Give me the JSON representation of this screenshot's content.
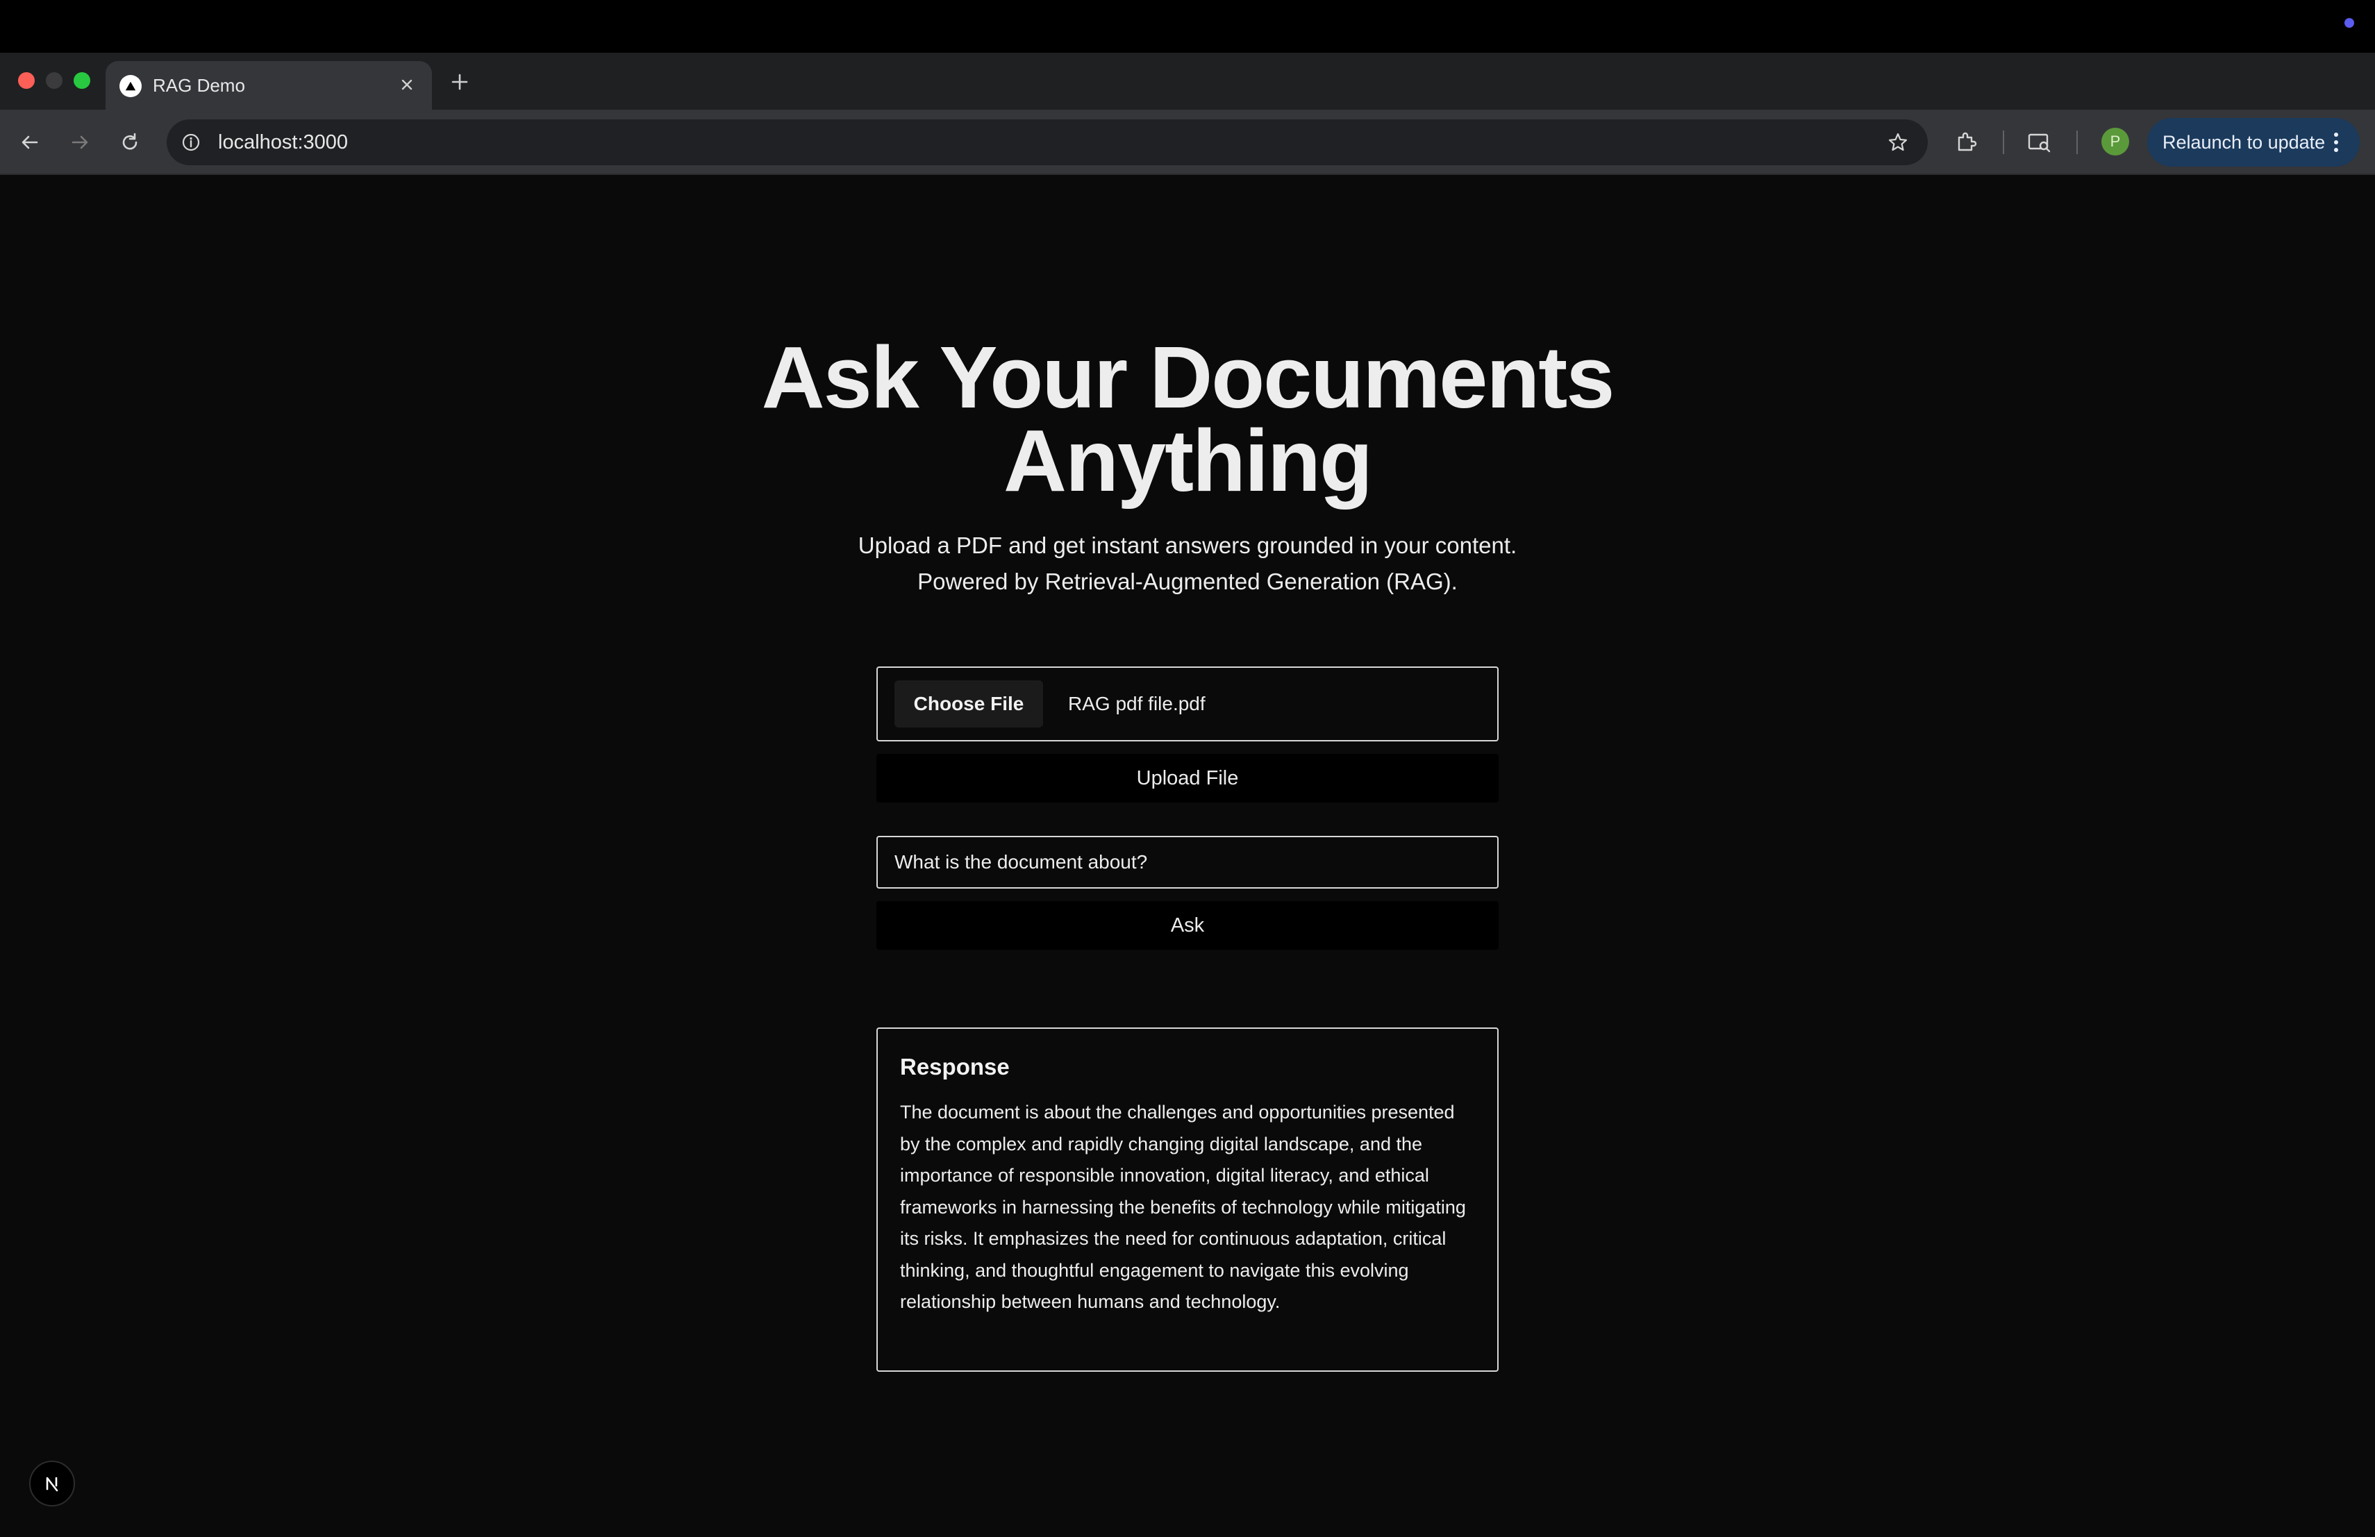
{
  "os": {
    "indicator_color": "#5b5cf0"
  },
  "browser": {
    "tab": {
      "title": "RAG Demo",
      "favicon": "triangle-icon"
    },
    "address": {
      "url": "localhost:3000"
    },
    "relaunch_label": "Relaunch to update",
    "profile_initial": "P",
    "accent": "#1b3a5c"
  },
  "page": {
    "title": "Ask Your Documents Anything",
    "subtitle_line1": "Upload a PDF and get instant answers grounded in your content.",
    "subtitle_line2": "Powered by Retrieval-Augmented Generation (RAG).",
    "file_picker": {
      "button_label": "Choose File",
      "file_name": "RAG pdf file.pdf"
    },
    "upload_label": "Upload File",
    "question": {
      "value": "What is the document about?"
    },
    "ask_label": "Ask",
    "response": {
      "heading": "Response",
      "text": "The document is about the challenges and opportunities presented by the complex and rapidly changing digital landscape, and the importance of responsible innovation, digital literacy, and ethical frameworks in harnessing the benefits of technology while mitigating its risks. It emphasizes the need for continuous adaptation, critical thinking, and thoughtful engagement to navigate this evolving relationship between humans and technology."
    },
    "dev_badge": {
      "label": "N",
      "icon": "nextjs-icon"
    }
  }
}
